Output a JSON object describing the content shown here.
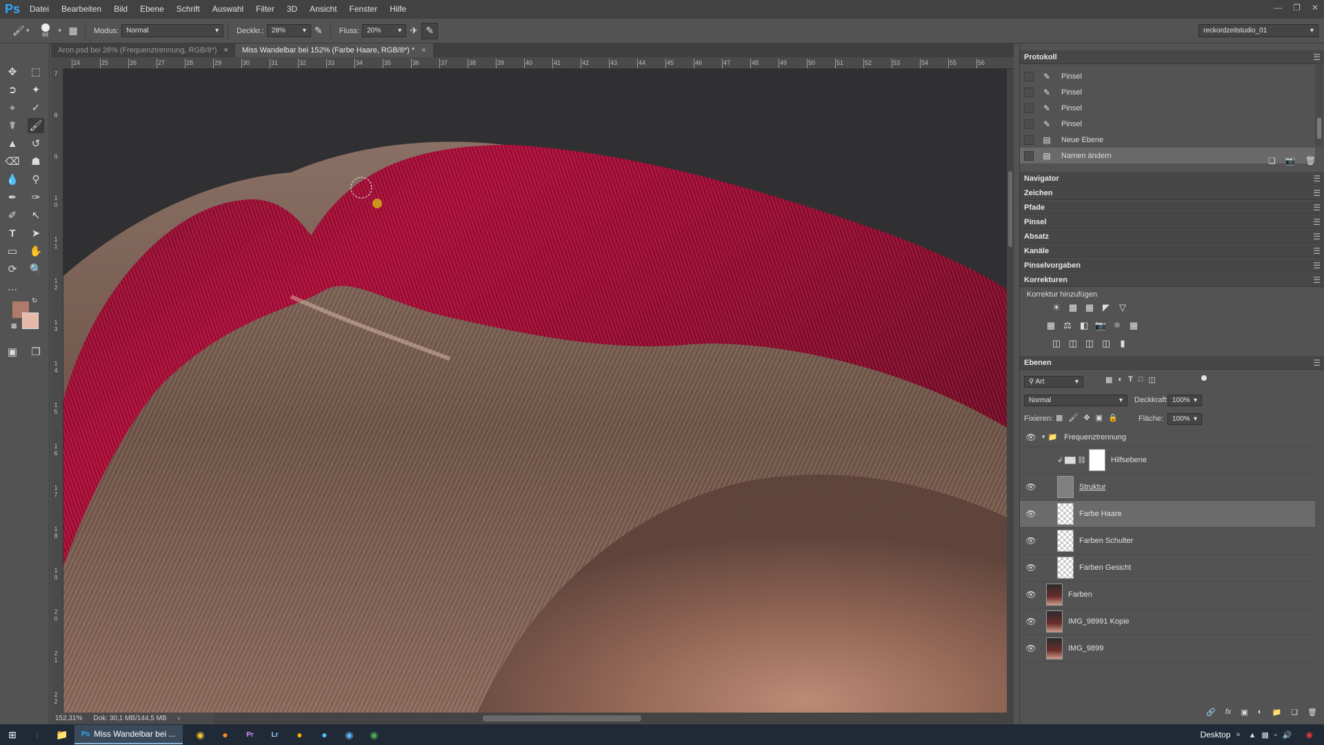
{
  "menu": {
    "logo": "Ps",
    "items": [
      "Datei",
      "Bearbeiten",
      "Bild",
      "Ebene",
      "Schrift",
      "Auswahl",
      "Filter",
      "3D",
      "Ansicht",
      "Fenster",
      "Hilfe"
    ]
  },
  "options": {
    "brush_size": "69",
    "modus_label": "Modus:",
    "modus_value": "Normal",
    "deckkr_label": "Deckkr.:",
    "deckkr_value": "28%",
    "fluss_label": "Fluss:",
    "fluss_value": "20%",
    "workspace": "reckordzeitstudio_01"
  },
  "tabs": [
    {
      "label": "Aron.psd bei 26% (Frequenztrennung, RGB/8*)",
      "active": false
    },
    {
      "label": "Miss Wandelbar bei 152% (Farbe Haare, RGB/8*) *",
      "active": true
    }
  ],
  "ruler_h": [
    "24",
    "25",
    "26",
    "27",
    "28",
    "29",
    "30",
    "31",
    "32",
    "33",
    "34",
    "35",
    "36",
    "37",
    "38",
    "39",
    "40",
    "41",
    "42",
    "43",
    "44",
    "45",
    "46",
    "47",
    "48",
    "49",
    "50",
    "51",
    "52",
    "53",
    "54",
    "55",
    "56"
  ],
  "ruler_v": [
    "7",
    "8",
    "9",
    "1 0",
    "1 1",
    "1 2",
    "1 3",
    "1 4",
    "1 5",
    "1 6",
    "1 7",
    "1 8",
    "1 9",
    "2 0",
    "2 1",
    "2 2"
  ],
  "status": {
    "zoom": "152,31%",
    "doc": "Dok: 30,1 MB/144,5 MB"
  },
  "history": {
    "title": "Protokoll",
    "items": [
      {
        "label": "Pinsel",
        "icon": "brush-icon",
        "selected": false
      },
      {
        "label": "Pinsel",
        "icon": "brush-icon",
        "selected": false
      },
      {
        "label": "Pinsel",
        "icon": "brush-icon",
        "selected": false
      },
      {
        "label": "Pinsel",
        "icon": "brush-icon",
        "selected": false
      },
      {
        "label": "Neue Ebene",
        "icon": "layer-doc-icon",
        "selected": false
      },
      {
        "label": "Namen ändern",
        "icon": "layer-doc-icon",
        "selected": true
      }
    ]
  },
  "collapsed_panels": [
    "Navigator",
    "Zeichen",
    "Pfade",
    "Pinsel",
    "Absatz",
    "Kanäle",
    "Pinselvorgaben"
  ],
  "korrekturen": {
    "title": "Korrekturen",
    "subtitle": "Korrektur hinzufügen"
  },
  "layers": {
    "title": "Ebenen",
    "filter_kind": "Art",
    "blend_mode": "Normal",
    "opacity_label": "Deckkraft:",
    "opacity_value": "100%",
    "lock_label": "Fixieren:",
    "fill_label": "Fläche:",
    "fill_value": "100%",
    "group_name": "Frequenztrennung",
    "rows": [
      {
        "name": "Hilfsebene",
        "thumb": "white",
        "visible": false,
        "selected": false,
        "adjust": true
      },
      {
        "name": "Struktur",
        "thumb": "gray",
        "visible": true,
        "selected": false,
        "adjust": false
      },
      {
        "name": "Farbe Haare",
        "thumb": "transparent",
        "visible": true,
        "selected": true,
        "adjust": false
      },
      {
        "name": "Farben Schulter",
        "thumb": "transparent",
        "visible": true,
        "selected": false,
        "adjust": false
      },
      {
        "name": "Farben Gesicht",
        "thumb": "transparent",
        "visible": true,
        "selected": false,
        "adjust": false
      },
      {
        "name": "Farben",
        "thumb": "photo",
        "visible": true,
        "selected": false,
        "adjust": false
      },
      {
        "name": "IMG_98991 Kopie",
        "thumb": "photo",
        "visible": true,
        "selected": false,
        "adjust": false
      },
      {
        "name": "IMG_9899",
        "thumb": "photo",
        "visible": true,
        "selected": false,
        "adjust": false
      }
    ]
  },
  "taskbar": {
    "app_label": "Miss Wandelbar bei ...",
    "desktop": "Desktop"
  },
  "colors": {
    "foreground": "#b07a6a",
    "background": "#e8b8a8",
    "hair_red": "#b5123c"
  }
}
